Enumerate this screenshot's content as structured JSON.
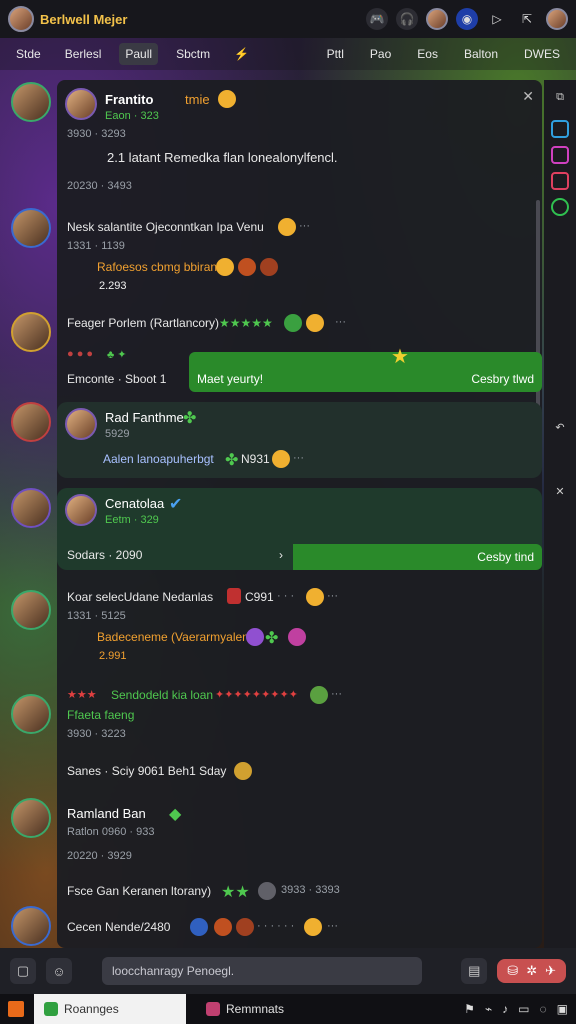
{
  "app": {
    "title": "Berlwell Mejer"
  },
  "topbar": {
    "icons": [
      "game-controller-icon",
      "headset-icon",
      "avatar-icon",
      "eye-icon",
      "camera-icon",
      "share-icon",
      "profile-icon"
    ]
  },
  "tabs": {
    "left": [
      "Stde",
      "Berlesl",
      "Paull",
      "Sbctm",
      "⚡"
    ],
    "active_index": 2,
    "right": [
      "Pttl",
      "Pao",
      "Eos",
      "Balton",
      "DWES"
    ]
  },
  "messages": [
    {
      "name": "Frantito",
      "badge": "tmie",
      "status": "Eaon · 323",
      "time": "3930 · 3293",
      "text": "2.1 latant Remedka flan lonealonylfencl.",
      "date": "20230 · 3493"
    },
    {
      "title": "Nesk salantite Ojeconntkan Ipa Venu",
      "time": "1331 · 1139",
      "text": "Rafoesos cbmg bbiran",
      "num": "2.293"
    },
    {
      "text": "Feager Porlem (Rartlancory)",
      "dots": "···"
    },
    {
      "meta": "Emconte · Sboot 1",
      "bar_left": "Maet yeurty!",
      "bar_right": "Cesbry tlwd"
    },
    {
      "name": "Rad Fanthme",
      "status": "5929",
      "text": "Aalen lanoapuherbgt",
      "extra": "N931"
    },
    {
      "name": "Cenatolaa",
      "status": "Eetm · 329",
      "bar_left": "Sodars · 2090",
      "bar_right": "Cesby tind"
    },
    {
      "title": "Koar selecUdane Nedanlas",
      "code": "C991",
      "time": "1331 · 5125",
      "text": "Badeceneme (Vaerarmyalengt",
      "num": "2.991"
    },
    {
      "title": "Sendodeld kia loan",
      "subtitle": "Ffaeta faeng",
      "time": "3930 · 3223",
      "text": "Sanes · Sciy 9061 Beh1 Sday"
    },
    {
      "name": "Ramland Ban",
      "status": "Ratlon 0960 · 933",
      "date": "20220 · 3929",
      "text": "Fsce Gan Keranen ltorany)",
      "extra": "3933 · 3393"
    },
    {
      "text": "Cecen Nende/2480",
      "dots": "···"
    }
  ],
  "composer": {
    "placeholder": "loocchanragy Penoegl."
  },
  "taskbar": {
    "item1": "Roannges",
    "item2": "Remmnats"
  },
  "colors": {
    "accent_green": "#2a8a2a",
    "name_yellow": "#f3c24a",
    "send_red": "#c85050"
  }
}
